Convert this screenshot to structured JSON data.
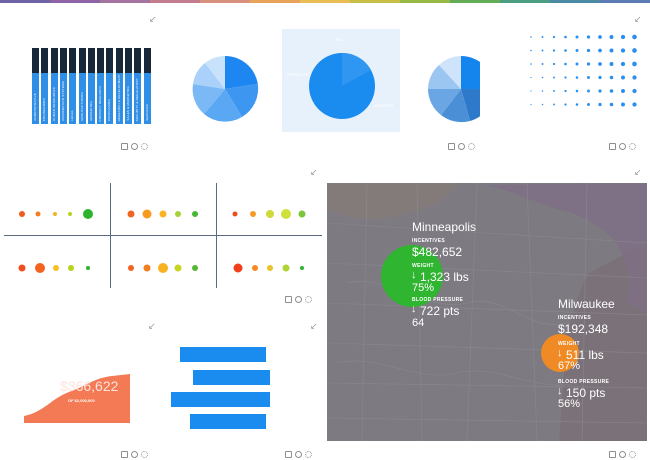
{
  "rainbow_colors": [
    "#6f63a8",
    "#8f64a6",
    "#a5739f",
    "#c27c8e",
    "#d9917f",
    "#e7a35a",
    "#e8bd53",
    "#c7be46",
    "#96b946",
    "#62ac57",
    "#4b9d84",
    "#4a8ba3",
    "#5c7ab4"
  ],
  "widgets": {
    "expand_icon": "expand-arrows-icon",
    "toolbar_icons": [
      "document-icon",
      "comment-icon",
      "gear-icon"
    ]
  },
  "vertical_bars": {
    "labels": [
      "ADMINISTRATIVE",
      "ENGINEERING",
      "HUMAN RESOURCES",
      "INFORMATION SYSTEMS",
      "LEGAL",
      "MANUFACTURING",
      "MARKETING",
      "PRODUCT RESEARCH",
      "PURCHASING",
      "RESEARCH & DEVELOPMENT",
      "SALES & MARKETING",
      "SECURITY & REGULATORY",
      "SERVICES"
    ],
    "fill_fraction": [
      0.67,
      0.67,
      0.67,
      0.67,
      0.67,
      0.67,
      0.67,
      0.67,
      0.67,
      0.67,
      0.67,
      0.67,
      0.67
    ]
  },
  "pie_center": {
    "labels": [
      "INC",
      "PROJECTS",
      "BUDGETS"
    ]
  },
  "progress_card": {
    "value": "$366,622",
    "subtitle": "OF $2,000,000"
  },
  "map": {
    "cities": [
      {
        "name": "Minneapolis",
        "incentives_label": "INCENTIVES",
        "incentives": "$482,652",
        "weight_label": "WEIGHT",
        "weight": "1,323 lbs",
        "weight_pct": "75%",
        "bp_label": "BLOOD PRESSURE",
        "bp": "722 pts",
        "bp_pct": "64",
        "color": "#2fb52f"
      },
      {
        "name": "Milwaukee",
        "incentives_label": "INCENTIVES",
        "incentives": "$192,348",
        "weight_label": "WEIGHT",
        "weight": "511 lbs",
        "weight_pct": "67%",
        "bp_label": "BLOOD PRESSURE",
        "bp": "150 pts",
        "bp_pct": "56%",
        "color": "#f08a24"
      }
    ]
  }
}
